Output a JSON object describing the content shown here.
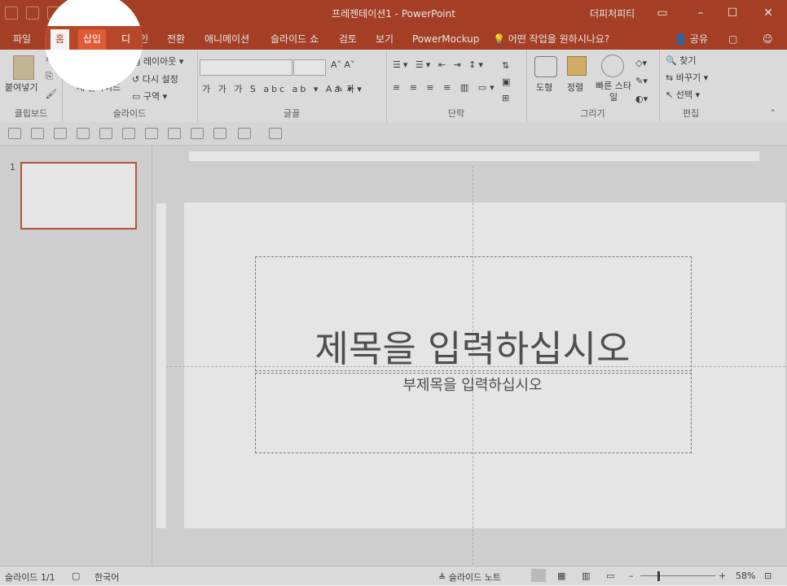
{
  "window": {
    "title": "프레젠테이션1 - PowerPoint",
    "user": "더피처피티"
  },
  "tabs": [
    "파일",
    "홈",
    "삽입",
    "디자인",
    "전환",
    "애니메이션",
    "슬라이드 쇼",
    "검토",
    "보기",
    "PowerMockup"
  ],
  "active_tab": "홈",
  "highlighted_tab": "삽입",
  "tell_me": "어떤 작업을 원하시나요?",
  "share": "공유",
  "ribbon": {
    "clipboard": {
      "label": "클립보드",
      "paste": "붙여넣기"
    },
    "slides": {
      "label": "슬라이드",
      "new_slide": "새 슬라이드",
      "layout": "레이아웃",
      "reset": "다시 설정",
      "section": "구역"
    },
    "font": {
      "label": "글꼴"
    },
    "paragraph": {
      "label": "단락"
    },
    "drawing": {
      "label": "그리기",
      "shapes": "도형",
      "arrange": "정렬",
      "quick_styles": "빠른 스타일"
    },
    "editing": {
      "label": "편집",
      "find": "찾기",
      "replace": "바꾸기",
      "select": "선택"
    }
  },
  "thumbnail": {
    "number": "1"
  },
  "slide": {
    "title_placeholder": "제목을 입력하십시오",
    "subtitle_placeholder": "부제목을 입력하십시오"
  },
  "status": {
    "slide_count": "슬라이드 1/1",
    "language": "한국어",
    "notes": "슬라이드 노트",
    "zoom": "58%"
  },
  "colors": {
    "accent": "#b7472a",
    "highlight": "#e05a33",
    "thumb_border": "#c5603f"
  }
}
